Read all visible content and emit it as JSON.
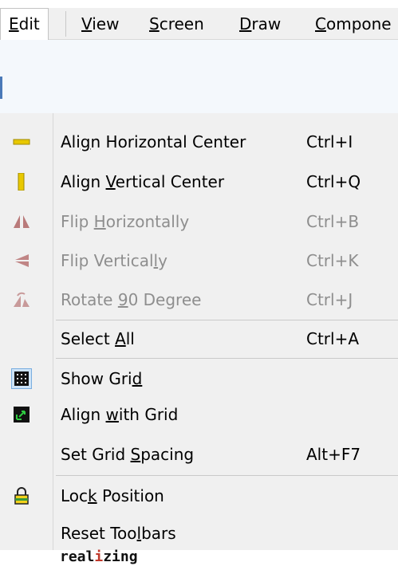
{
  "menubar": {
    "items": [
      {
        "label": "Edit",
        "mnemonic": "E",
        "active": true
      },
      {
        "label": "View",
        "mnemonic": "V",
        "active": false
      },
      {
        "label": "Screen",
        "mnemonic": "S",
        "active": false
      },
      {
        "label": "Draw",
        "mnemonic": "D",
        "active": false
      },
      {
        "label": "Compone",
        "mnemonic": "C",
        "active": false
      }
    ]
  },
  "edit_menu": {
    "items": [
      {
        "label": "Align Horizontal Center",
        "mnemonic_index": 3,
        "shortcut": "Ctrl+I",
        "enabled": true,
        "icon": "align-horizontal-center-icon"
      },
      {
        "label": "Align Vertical Center",
        "mnemonic_index": 6,
        "shortcut": "Ctrl+Q",
        "enabled": true,
        "icon": "align-vertical-center-icon"
      },
      {
        "label": "Flip Horizontally",
        "mnemonic_index": 5,
        "shortcut": "Ctrl+B",
        "enabled": false,
        "icon": "flip-horizontal-icon"
      },
      {
        "label": "Flip Vertically",
        "mnemonic_index": 13,
        "shortcut": "Ctrl+K",
        "enabled": false,
        "icon": "flip-vertical-icon"
      },
      {
        "label": "Rotate 90 Degree",
        "mnemonic_index": 7,
        "shortcut": "Ctrl+J",
        "enabled": false,
        "icon": "rotate-icon"
      },
      {
        "label": "Select All",
        "mnemonic_index": 7,
        "shortcut": "Ctrl+A",
        "enabled": true,
        "icon": ""
      },
      {
        "label": "Show Grid",
        "mnemonic_index": 8,
        "shortcut": "",
        "enabled": true,
        "checked": true,
        "icon": "grid-icon"
      },
      {
        "label": "Align with Grid",
        "mnemonic_index": 6,
        "shortcut": "",
        "enabled": true,
        "checked": true,
        "icon": "align-grid-icon"
      },
      {
        "label": "Set Grid Spacing",
        "mnemonic_index": 9,
        "shortcut": "Alt+F7",
        "enabled": true,
        "icon": ""
      },
      {
        "label": "Lock Position",
        "mnemonic_index": 3,
        "shortcut": "",
        "enabled": true,
        "icon": "lock-icon"
      },
      {
        "label": "Reset Toolbars",
        "mnemonic_index": 9,
        "shortcut": "",
        "enabled": true,
        "icon": ""
      }
    ]
  },
  "footer": {
    "text": "realizing"
  },
  "colors": {
    "menu_bg": "#f0f0f0",
    "disabled_text": "#8e8e8e",
    "checked_icon_bg": "#cde3f7",
    "icon_yellow": "#e8c800"
  }
}
